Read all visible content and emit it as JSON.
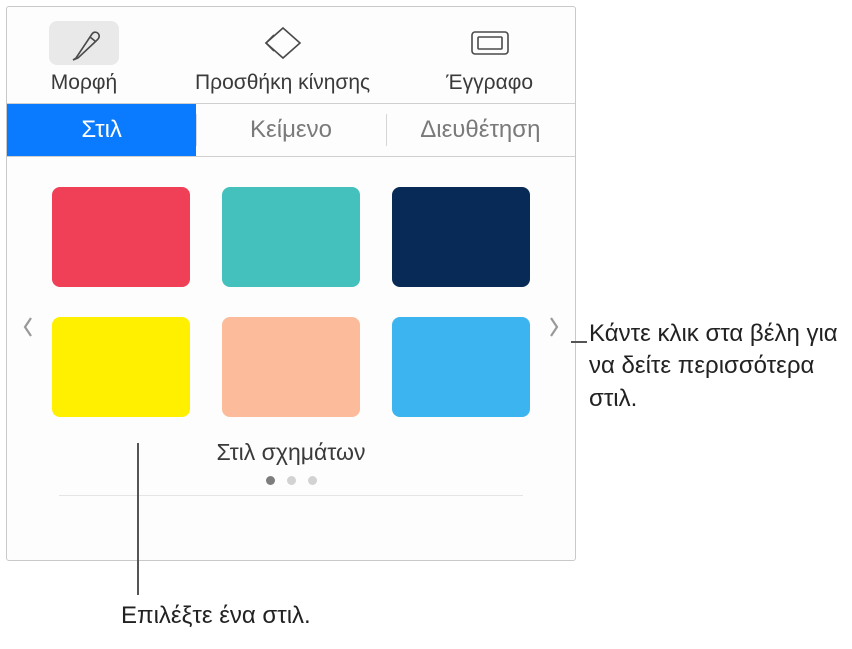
{
  "topTabs": {
    "format": "Μορφή",
    "animate": "Προσθήκη κίνησης",
    "document": "Έγγραφο"
  },
  "subTabs": {
    "style": "Στιλ",
    "text": "Κείμενο",
    "arrange": "Διευθέτηση"
  },
  "swatches": [
    {
      "color": "#ef4058"
    },
    {
      "color": "#44c1bd"
    },
    {
      "color": "#082a56"
    },
    {
      "color": "#fff000"
    },
    {
      "color": "#fcbb9a"
    },
    {
      "color": "#3cb4ef"
    }
  ],
  "stylesCaption": "Στιλ σχημάτων",
  "callouts": {
    "arrows": "Κάντε κλικ στα βέλη για να δείτε περισσότερα στιλ.",
    "select": "Επιλέξτε ένα στιλ."
  }
}
